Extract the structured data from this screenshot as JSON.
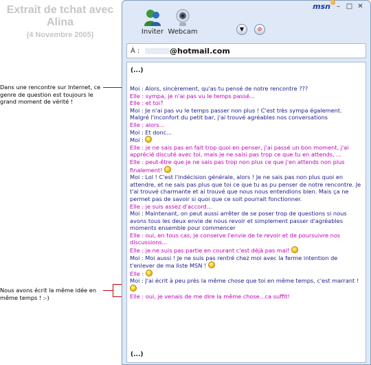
{
  "caption": {
    "title": "Extrait de tchat avec Alina",
    "date": "(4 Novembre 2005)"
  },
  "notes": [
    {
      "text": "Dans une rencontre sur Internet, ce genre de question est toujours le grand moment de vérité !"
    },
    {
      "text": "Nous avons écrit la même idée en même temps ! :-)"
    }
  ],
  "window": {
    "logo": "msn",
    "toolbar": {
      "invite_label": "Inviter",
      "webcam_label": "Webcam"
    },
    "to_field": {
      "label": "À :",
      "value": "@hotmail.com"
    },
    "colors": {
      "moi": "#1b1b8c",
      "elle": "#c000b8",
      "border": "#7f9db9",
      "frame": "#dfe8f6"
    },
    "chat": {
      "top_ellipsis": "(...)",
      "bottom_ellipsis": "(...)",
      "messages": [
        {
          "who": "moi",
          "text": "Moi : Alors, sincèrement, qu'as tu pensé de notre rencontre ???"
        },
        {
          "who": "elle",
          "text": "Elle : sympa, je n'ai pas vu le temps passé..."
        },
        {
          "who": "elle",
          "text": "Elle : et toi?"
        },
        {
          "who": "moi",
          "text": "Moi : Je n'ai pas vu le temps passer non plus ! C'est très sympa également. Malgré l'inconfort du petit bar, j'ai trouvé agréables nos conversations"
        },
        {
          "who": "elle",
          "text": "Elle : alors..."
        },
        {
          "who": "moi",
          "text": "Moi : Et donc..."
        },
        {
          "who": "moi",
          "text": "Moi :",
          "smiley": true
        },
        {
          "who": "elle",
          "text": "Elle : je ne sais pas en fait trop quoi en penser, j'ai passé un bon moment, j'ai apprécié discuté avec toi, mais je ne saisi pas trop ce que tu en attends, ..."
        },
        {
          "who": "elle",
          "text": "Elle : peut-être que je ne sais pas trop non plus ce que j'en attends non plus finalement!",
          "smiley": true
        },
        {
          "who": "moi",
          "text": "Moi : Lol ! C'est l'indécision générale, alors ! Je ne sais pas non plus quoi en attendre, et ne sais pas plus que toi ce que tu as pu penser de notre rencontre. Je t'ai trouvé charmante et ai trouvé que nous nous entendions bien. Mais ça ne permet pas de savoir si quoi que ce soit pourrait fonctionner."
        },
        {
          "who": "elle",
          "text": "Elle : je suis assez d'accord..."
        },
        {
          "who": "moi",
          "text": "Moi : Maintenant, on peut aussi arrêter de se poser trop de questions si nous avons tous les deux envie de nous revoir et simplement passer d'agréables moments ensemble pour commencer"
        },
        {
          "who": "elle",
          "text": "Elle : oui, en tous cas, je conserve l'envie de te revoir et de poursuivre nos discussions..."
        },
        {
          "who": "elle",
          "text": "Elle : je ne suis pas partie en courant c'est déjà pas mal!",
          "smiley": true
        },
        {
          "who": "moi",
          "text": "Moi : Moi aussi ! Je ne suis pas rentré chez moi avec la ferme intention de t'enlever de ma liste MSN !",
          "smiley": true
        },
        {
          "who": "elle",
          "text": "Elle :",
          "smiley": true
        },
        {
          "who": "moi",
          "text": "Moi : J'ai écrit à peu près la même chose que toi en même temps, c'est marrant !",
          "smiley": true
        },
        {
          "who": "elle",
          "text": "Elle : oui, je venais de me dire la même chose...ca suffit!"
        }
      ]
    }
  }
}
